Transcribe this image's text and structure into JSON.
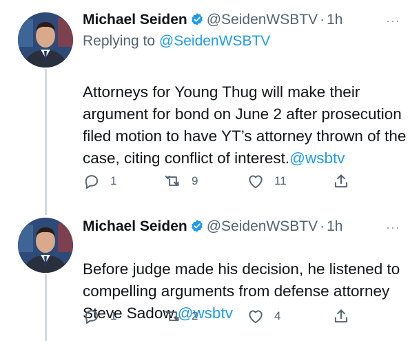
{
  "tweets": [
    {
      "author_name": "Michael Seiden",
      "handle": "@SeidenWSBTV",
      "separator": "·",
      "time": "1h",
      "reply_prefix": "Replying to ",
      "reply_to": "@SeidenWSBTV",
      "text": "Attorneys for Young Thug will make their argument for bond on June 2 after prosecution filed motion to have YT’s attorney thrown of the case, citing conflict of interest.",
      "link": "@wsbtv",
      "replies": "1",
      "retweets": "9",
      "likes": "11"
    },
    {
      "author_name": "Michael Seiden",
      "handle": "@SeidenWSBTV",
      "separator": "·",
      "time": "1h",
      "text": "Before judge made his decision, he listened to compelling arguments from defense attorney Steve Sadow.",
      "link": "@wsbtv",
      "replies": "1",
      "retweets": "2",
      "likes": "4"
    }
  ],
  "more_label": "···",
  "colors": {
    "accent": "#1d9bf0",
    "secondary": "#536471",
    "thread_line": "#cfd9de"
  },
  "icons": [
    "verified-badge-icon",
    "reply-icon",
    "retweet-icon",
    "like-icon",
    "share-icon",
    "more-icon"
  ]
}
